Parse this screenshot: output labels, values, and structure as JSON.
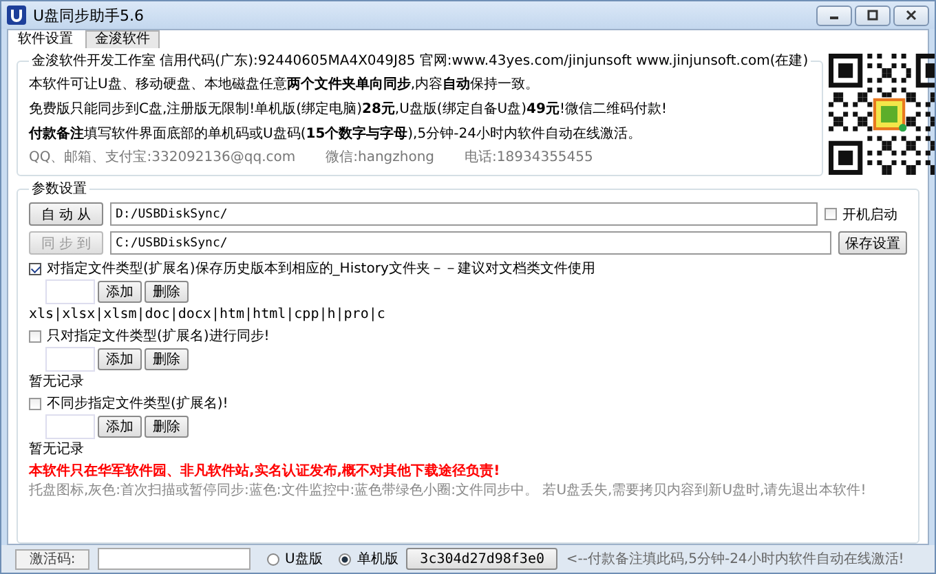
{
  "window": {
    "title": "U盘同步助手5.6"
  },
  "tabs": [
    {
      "label": "软件设置",
      "selected": true
    },
    {
      "label": "金浚软件",
      "selected": false
    }
  ],
  "info": {
    "legend": "金浚软件开发工作室 信用代码(广东):92440605MA4X049J85 官网:www.43yes.com/jinjunsoft  www.jinjunsoft.com(在建)",
    "lines": [
      "本软件可让U盘、移动硬盘、本地磁盘任意**两个文件夹单向同步**,内容**自动**保持一致。",
      "免费版只能同步到C盘,注册版无限制!单机版(绑定电脑)**28元**,U盘版(绑定自备U盘)**49元**!微信二维码付款!",
      "**付款备注**填写软件界面底部的单机码或U盘码(**15个数字与字母**),5分钟-24小时内软件自动在线激活。"
    ],
    "contacts": [
      "QQ、邮箱、支付宝:332092136@qq.com",
      "微信:hangzhong",
      "电话:18934355455"
    ]
  },
  "params": {
    "legend": "参数设置",
    "paths": [
      {
        "button": "自 动 从",
        "value": "D:/USBDiskSync/",
        "disabled": false
      },
      {
        "button": "同 步 到",
        "value": "C:/USBDiskSync/",
        "disabled": true
      }
    ],
    "autostart": {
      "label": "开机启动",
      "checked": false
    },
    "save_button": "保存设置",
    "filters": [
      {
        "label": "对指定文件类型(扩展名)保存历史版本到相应的_History文件夹－－建议对文档类文件使用",
        "checked": true,
        "add_button": "添加",
        "delete_button": "删除",
        "records": "xls|xlsx|xlsm|doc|docx|htm|html|cpp|h|pro|c"
      },
      {
        "label": "只对指定文件类型(扩展名)进行同步!",
        "checked": false,
        "add_button": "添加",
        "delete_button": "删除",
        "records": "暂无记录"
      },
      {
        "label": "不同步指定文件类型(扩展名)!",
        "checked": false,
        "add_button": "添加",
        "delete_button": "删除",
        "records": "暂无记录"
      }
    ]
  },
  "notice": "本软件只在华军软件园、非凡软件站,实名认证发布,概不对其他下载途径负责!",
  "tray_help": "托盘图标,灰色:首次扫描或暂停同步:蓝色:文件监控中:蓝色带绿色小圈:文件同步中。  若U盘丢失,需要拷贝内容到新U盘时,请先退出本软件!",
  "status_bar": {
    "activation_label": "激活码:",
    "editions": [
      {
        "label": "U盘版",
        "selected": false
      },
      {
        "label": "单机版",
        "selected": true
      }
    ],
    "code": "3c304d27d98f3e0",
    "hint": "<--付款备注填此码,5分钟-24小时内软件自动在线激活!"
  }
}
